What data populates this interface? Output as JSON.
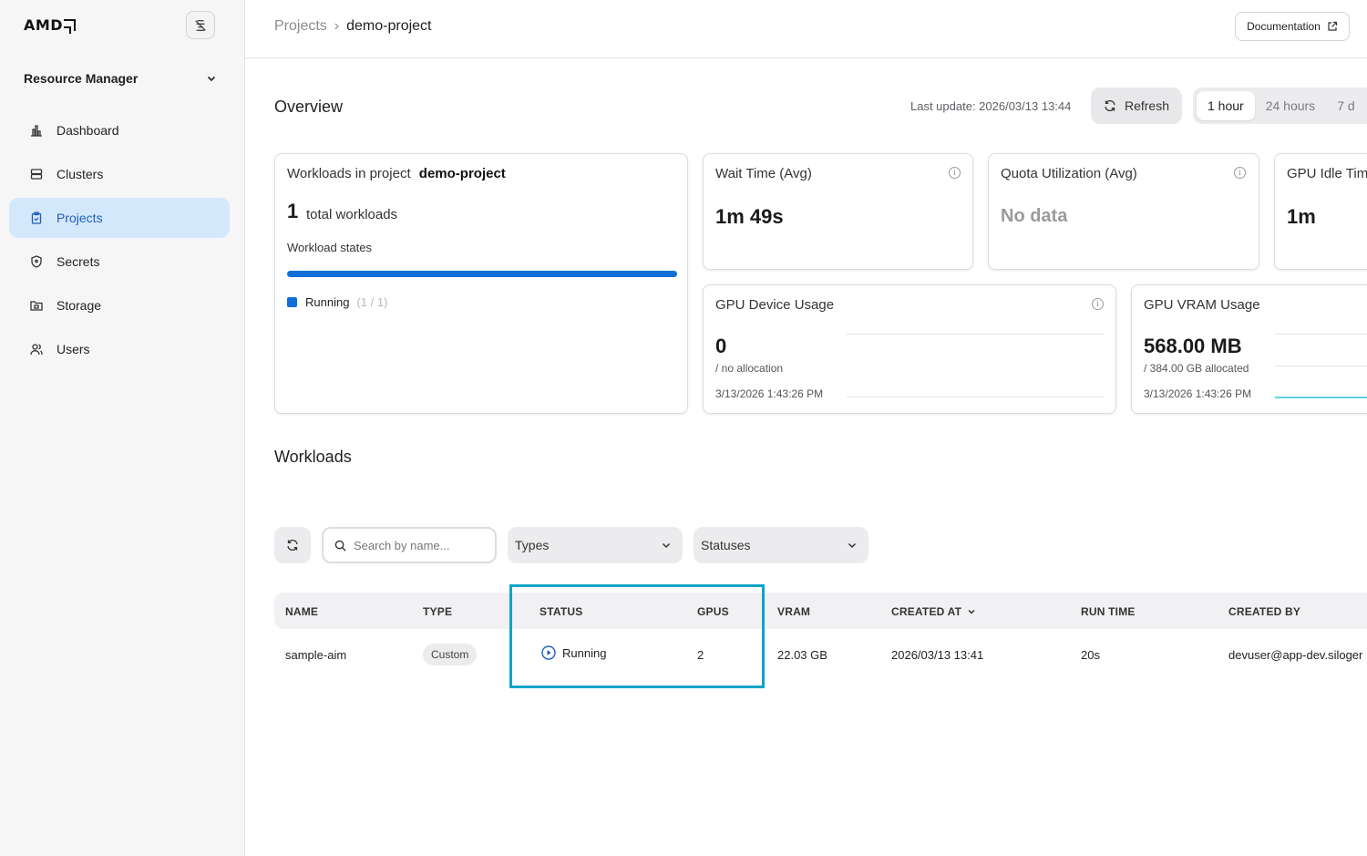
{
  "sidebar": {
    "logo": "AMD",
    "section": "Resource Manager",
    "items": [
      {
        "label": "Dashboard",
        "icon": "bar-chart-icon",
        "active": false
      },
      {
        "label": "Clusters",
        "icon": "server-icon",
        "active": false
      },
      {
        "label": "Projects",
        "icon": "clipboard-icon",
        "active": true
      },
      {
        "label": "Secrets",
        "icon": "shield-icon",
        "active": false
      },
      {
        "label": "Storage",
        "icon": "folder-icon",
        "active": false
      },
      {
        "label": "Users",
        "icon": "users-icon",
        "active": false
      }
    ]
  },
  "topbar": {
    "breadcrumb_parent": "Projects",
    "breadcrumb_current": "demo-project",
    "documentation": "Documentation"
  },
  "overview": {
    "title": "Overview",
    "last_update": "Last update: 2026/03/13 13:44",
    "refresh": "Refresh",
    "ranges": [
      "1 hour",
      "24 hours",
      "7 d"
    ],
    "workloads_card": {
      "title_prefix": "Workloads in project",
      "project": "demo-project",
      "total": "1",
      "total_label": "total workloads",
      "states_label": "Workload states",
      "running_fraction": 1.0,
      "legend_label": "Running",
      "legend_count": "(1 / 1)"
    },
    "wait_time": {
      "title": "Wait Time (Avg)",
      "value": "1m 49s"
    },
    "quota": {
      "title": "Quota Utilization (Avg)",
      "value": "No data"
    },
    "gpu_idle": {
      "title": "GPU Idle Tim",
      "value": "1m"
    },
    "gpu_device": {
      "title": "GPU Device Usage",
      "value": "0",
      "sub": "/ no allocation",
      "timestamp": "3/13/2026 1:43:26 PM"
    },
    "gpu_vram": {
      "title": "GPU VRAM Usage",
      "value": "568.00 MB",
      "sub": "/ 384.00 GB allocated",
      "timestamp": "3/13/2026 1:43:26 PM"
    }
  },
  "workloads": {
    "title": "Workloads",
    "search_placeholder": "Search by name...",
    "types_filter": "Types",
    "statuses_filter": "Statuses",
    "columns": {
      "name": "NAME",
      "type": "TYPE",
      "status": "STATUS",
      "gpus": "GPUS",
      "vram": "VRAM",
      "created_at": "CREATED AT",
      "run_time": "RUN TIME",
      "created_by": "CREATED BY"
    },
    "rows": [
      {
        "name": "sample-aim",
        "type": "Custom",
        "status": "Running",
        "gpus": "2",
        "vram": "22.03 GB",
        "created_at": "2026/03/13 13:41",
        "run_time": "20s",
        "created_by": "devuser@app-dev.siloger"
      }
    ]
  },
  "colors": {
    "accent": "#0f6fd6",
    "active_nav_bg": "#d4e8fb",
    "highlight": "#0aa5c9",
    "vram_line": "#5cd6e8"
  }
}
